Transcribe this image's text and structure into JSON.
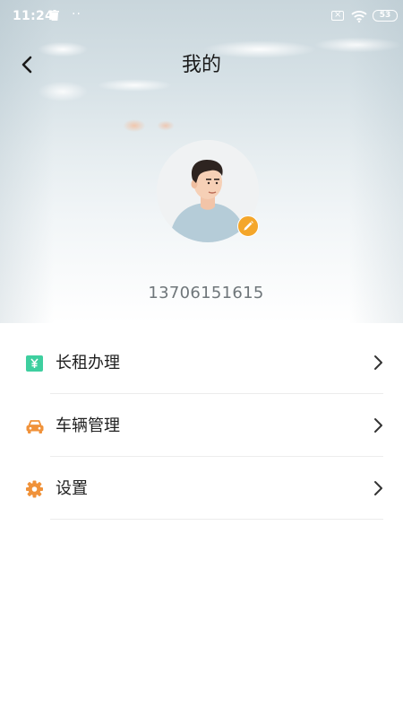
{
  "status_bar": {
    "time": "11:24",
    "dots": "··",
    "sim_indicator": "×",
    "battery_level": "53"
  },
  "header": {
    "title": "我的"
  },
  "profile": {
    "phone": "13706151615"
  },
  "menu": {
    "items": [
      {
        "label": "长租办理",
        "icon": "yen-card-icon",
        "color": "#3ecf9f"
      },
      {
        "label": "车辆管理",
        "icon": "car-icon",
        "color": "#f0923a"
      },
      {
        "label": "设置",
        "icon": "gear-icon",
        "color": "#f0923a"
      }
    ]
  },
  "colors": {
    "edit_badge": "#f4a62a",
    "title_text": "#1a1a1a",
    "phone_text": "#6f767a"
  }
}
